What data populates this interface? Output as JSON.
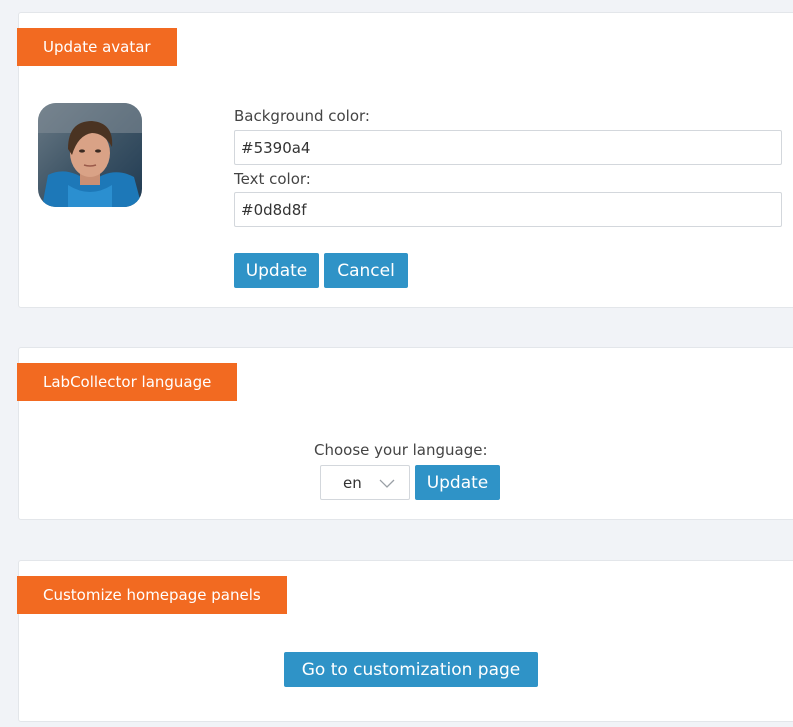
{
  "avatar_section": {
    "header": "Update avatar",
    "background_color_label": "Background color:",
    "background_color_value": "#5390a4",
    "text_color_label": "Text color:",
    "text_color_value": "#0d8d8f",
    "update_button": "Update",
    "cancel_button": "Cancel"
  },
  "language_section": {
    "header": "LabCollector language",
    "choose_label": "Choose your language:",
    "selected_language": "en",
    "update_button": "Update"
  },
  "homepage_section": {
    "header": "Customize homepage panels",
    "customize_button": "Go to customization page"
  },
  "colors": {
    "accent_orange": "#f26a21",
    "button_blue": "#2f93c7",
    "page_background": "#f1f3f7"
  }
}
